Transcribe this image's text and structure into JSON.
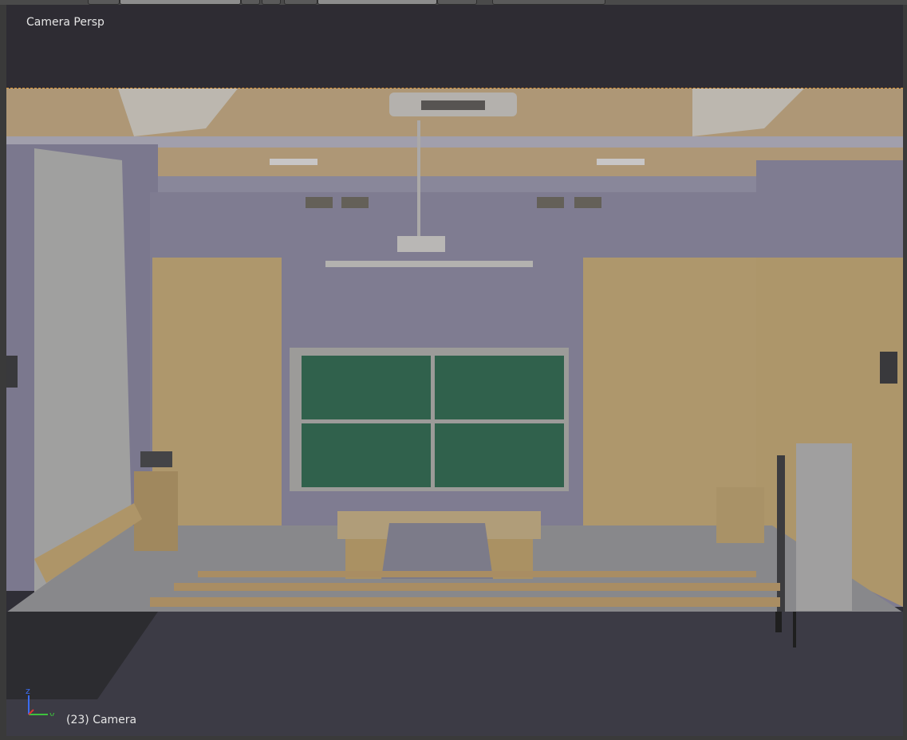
{
  "viewport": {
    "view_label": "Camera Persp",
    "object_label": "(23) Camera"
  },
  "axis_gizmo": {
    "z_label": "z",
    "y_label": "y",
    "x_color": "#d33",
    "y_color": "#3c3",
    "z_color": "#36f"
  },
  "colors": {
    "viewport_bg": "#2e2c33",
    "camera_frame_border": "#e09a3c",
    "wall": "#8f8ca2",
    "wood": "#c9ad74",
    "chalkboard": "#2f6b4e",
    "floor": "#9a9a9a"
  }
}
